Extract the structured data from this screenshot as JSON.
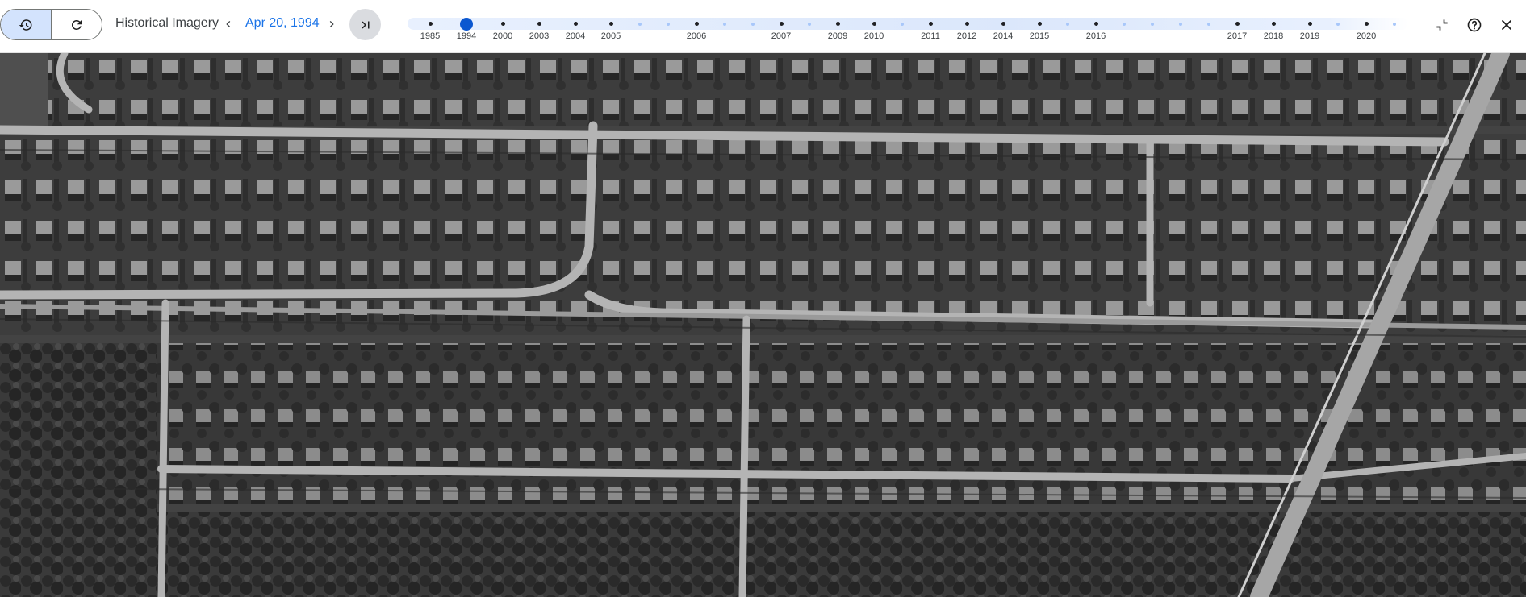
{
  "header": {
    "title": "Historical Imagery",
    "current_date": "Apr 20, 1994"
  },
  "timeline": {
    "selected": "1994",
    "labeled_years": [
      "1985",
      "1994",
      "2000",
      "2003",
      "2004",
      "2005",
      "2006",
      "2007",
      "2009",
      "2010",
      "2011",
      "2012",
      "2014",
      "2015",
      "2016",
      "2017",
      "2018",
      "2019",
      "2020"
    ]
  },
  "icons": {
    "history_mode": "history-icon",
    "current_mode": "refresh-icon",
    "prev": "chevron-left-icon",
    "next": "chevron-right-icon",
    "latest": "skip-to-latest-icon",
    "collapse": "collapse-icon",
    "help": "help-icon",
    "close": "close-icon"
  },
  "colors": {
    "accent": "#1a73e8",
    "selected_dot": "#0b57d0",
    "active_segment": "#d3e3fd"
  }
}
